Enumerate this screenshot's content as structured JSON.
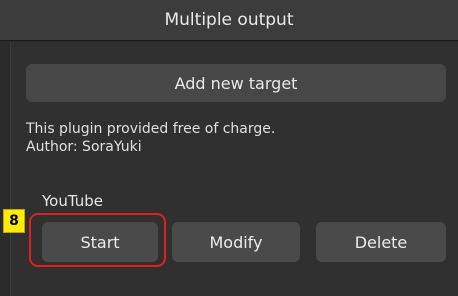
{
  "window": {
    "title": "Multiple output"
  },
  "toolbar": {
    "add_label": "Add new target"
  },
  "info": {
    "line1": "This plugin provided free of charge.",
    "line2": "Author: SoraYuki"
  },
  "target": {
    "name": "YouTube",
    "start_label": "Start",
    "modify_label": "Modify",
    "delete_label": "Delete"
  },
  "annotation": {
    "number": "8",
    "highlight_color": "#e02020",
    "badge_color": "#ffeb00"
  }
}
